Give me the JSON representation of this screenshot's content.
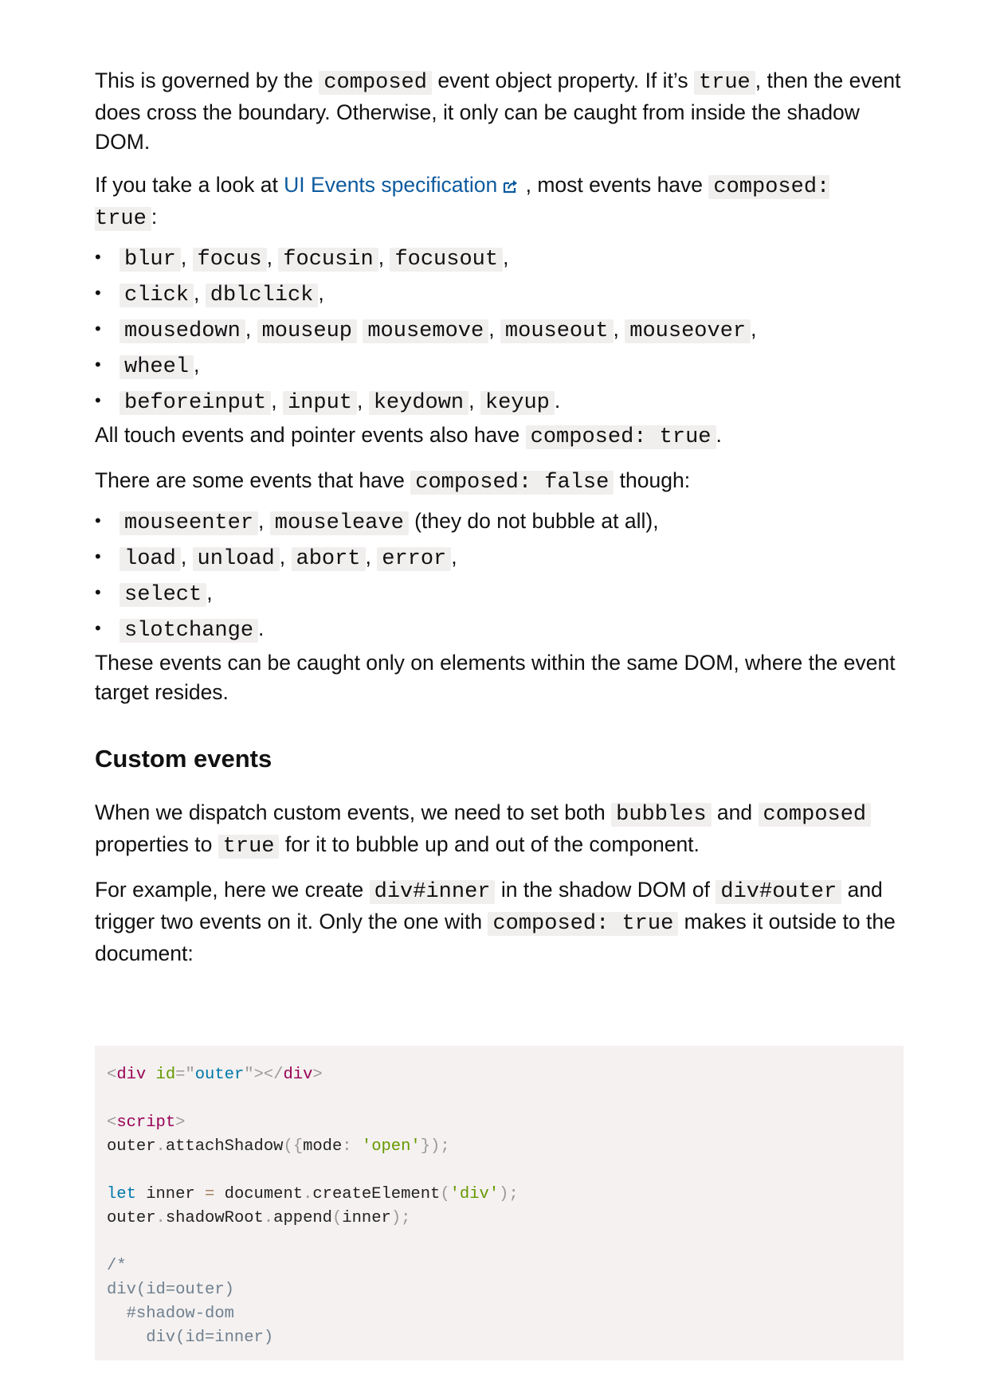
{
  "p1": {
    "text_a": "This is governed by the ",
    "code_a": "composed",
    "text_b": " event object property. If it’s ",
    "code_b": "true",
    "text_c": ", then the event does cross the boundary. Otherwise, it only can be caught from inside the shadow DOM."
  },
  "p2": {
    "text_a": "If you take a look at ",
    "link": "UI Events specification",
    "link_icon": "external-link-icon",
    "text_b": " , most events have ",
    "code": "composed: true",
    "text_c": ":"
  },
  "list1": [
    {
      "codes": [
        "blur",
        "focus",
        "focusin",
        "focusout"
      ],
      "seps": [
        ", ",
        ", ",
        ", ",
        ","
      ]
    },
    {
      "codes": [
        "click",
        "dblclick"
      ],
      "seps": [
        ", ",
        ","
      ]
    },
    {
      "codes": [
        "mousedown",
        "mouseup",
        "mousemove",
        "mouseout",
        "mouseover"
      ],
      "seps": [
        ", ",
        " ",
        ", ",
        ", ",
        ","
      ]
    },
    {
      "codes": [
        "wheel"
      ],
      "seps": [
        ","
      ]
    },
    {
      "codes": [
        "beforeinput",
        "input",
        "keydown",
        "keyup"
      ],
      "seps": [
        ", ",
        ", ",
        ", ",
        "."
      ]
    }
  ],
  "p3": {
    "text_a": "All touch events and pointer events also have ",
    "code": "composed: true",
    "text_b": "."
  },
  "p4": {
    "text_a": "There are some events that have ",
    "code": "composed: false",
    "text_b": " though:"
  },
  "list2": [
    {
      "codes": [
        "mouseenter",
        "mouseleave"
      ],
      "seps": [
        ", ",
        " (they do not bubble at all),"
      ]
    },
    {
      "codes": [
        "load",
        "unload",
        "abort",
        "error"
      ],
      "seps": [
        ", ",
        ", ",
        ", ",
        ","
      ]
    },
    {
      "codes": [
        "select"
      ],
      "seps": [
        ","
      ]
    },
    {
      "codes": [
        "slotchange"
      ],
      "seps": [
        "."
      ]
    }
  ],
  "p5": {
    "text": "These events can be caught only on elements within the same DOM, where the event target resides."
  },
  "heading": "Custom events",
  "p6": {
    "text_a": "When we dispatch custom events, we need to set both ",
    "code_a": "bubbles",
    "text_b": " and ",
    "code_b": "composed",
    "text_c": " properties to ",
    "code_c": "true",
    "text_d": " for it to bubble up and out of the component."
  },
  "p7": {
    "text_a": "For example, here we create ",
    "code_a": "div#inner",
    "text_b": " in the shadow DOM of ",
    "code_b": "div#outer",
    "text_c": " and trigger two events on it. Only the one with ",
    "code_c": "composed: true",
    "text_d": " makes it outside to the document:"
  },
  "code_lines": [
    [
      [
        "punc",
        "<"
      ],
      [
        "tag",
        "div"
      ],
      [
        "plain",
        " "
      ],
      [
        "attr",
        "id"
      ],
      [
        "punc",
        "=\""
      ],
      [
        "val",
        "outer"
      ],
      [
        "punc",
        "\">"
      ],
      [
        "punc",
        "</"
      ],
      [
        "tag",
        "div"
      ],
      [
        "punc",
        ">"
      ]
    ],
    [],
    [
      [
        "punc",
        "<"
      ],
      [
        "tag",
        "script"
      ],
      [
        "punc",
        ">"
      ]
    ],
    [
      [
        "plain",
        "outer"
      ],
      [
        "punc",
        "."
      ],
      [
        "plain",
        "attachShadow"
      ],
      [
        "punc",
        "({"
      ],
      [
        "plain",
        "mode"
      ],
      [
        "punc",
        ":"
      ],
      [
        "plain",
        " "
      ],
      [
        "str",
        "'open'"
      ],
      [
        "punc",
        "});"
      ]
    ],
    [],
    [
      [
        "kw",
        "let"
      ],
      [
        "plain",
        " inner "
      ],
      [
        "op",
        "="
      ],
      [
        "plain",
        " document"
      ],
      [
        "punc",
        "."
      ],
      [
        "plain",
        "createElement"
      ],
      [
        "punc",
        "("
      ],
      [
        "str",
        "'div'"
      ],
      [
        "punc",
        ");"
      ]
    ],
    [
      [
        "plain",
        "outer"
      ],
      [
        "punc",
        "."
      ],
      [
        "plain",
        "shadowRoot"
      ],
      [
        "punc",
        "."
      ],
      [
        "plain",
        "append"
      ],
      [
        "punc",
        "("
      ],
      [
        "plain",
        "inner"
      ],
      [
        "punc",
        ");"
      ]
    ],
    [],
    [
      [
        "cmt",
        "/*"
      ]
    ],
    [
      [
        "cmt",
        "div(id=outer)"
      ]
    ],
    [
      [
        "cmt",
        "  #shadow-dom"
      ]
    ],
    [
      [
        "cmt",
        "    div(id=inner)"
      ]
    ]
  ],
  "colors": {
    "link": "#0c5a9e",
    "inline_code_bg": "#f1eeee",
    "code_block_bg": "#f4f1f0",
    "token_tag": "#990055",
    "token_attr": "#669900",
    "token_value": "#0077aa",
    "token_keyword": "#0077aa",
    "token_comment": "#708090",
    "token_punctuation": "#9a9a9a"
  }
}
